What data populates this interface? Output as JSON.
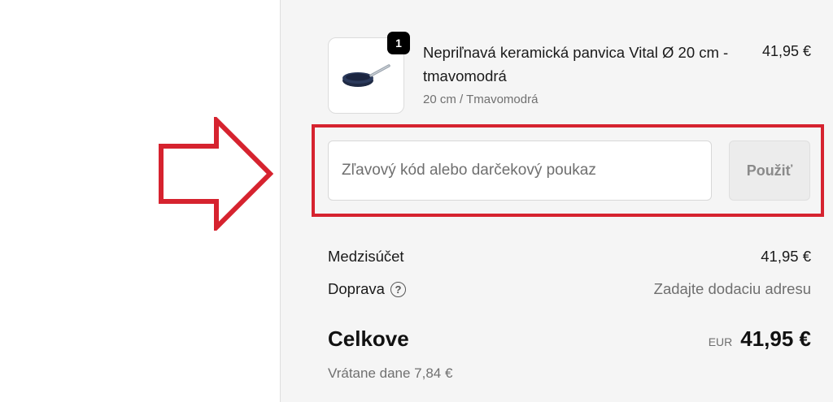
{
  "cart_item": {
    "quantity": "1",
    "name": "Nepriľnavá keramická panvica Vital Ø 20 cm - tmavomodrá",
    "variant": "20 cm / Tmavomodrá",
    "price": "41,95 €",
    "image_icon": "frying-pan-icon"
  },
  "discount": {
    "placeholder": "Zľavový kód alebo darčekový poukaz",
    "value": "",
    "apply_label": "Použiť"
  },
  "annotation": {
    "arrow_icon": "arrow-right-icon",
    "color": "#d6232f"
  },
  "summary": {
    "subtotal_label": "Medzisúčet",
    "subtotal_value": "41,95 €",
    "shipping_label": "Doprava",
    "shipping_help_icon": "question-circle-icon",
    "shipping_value": "Zadajte dodaciu adresu",
    "total_label": "Celkove",
    "currency_code": "EUR",
    "total_value": "41,95 €",
    "tax_note": "Vrátane dane 7,84 €"
  }
}
